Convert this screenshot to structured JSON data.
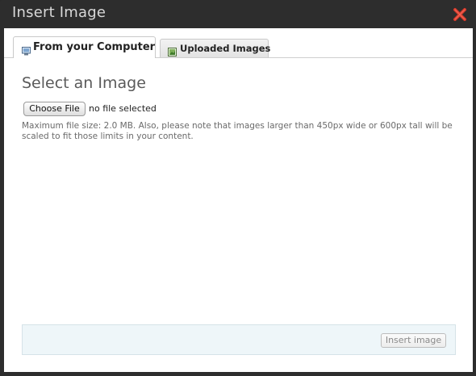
{
  "dialog": {
    "title": "Insert Image",
    "close_icon": "close-x-icon"
  },
  "tabs": [
    {
      "label": "From your Computer",
      "icon": "computer-icon",
      "active": true
    },
    {
      "label": "Uploaded Images",
      "icon": "image-icon",
      "active": false
    }
  ],
  "upload": {
    "heading": "Select an Image",
    "choose_label": "Choose File",
    "file_status": "no file selected",
    "hint": "Maximum file size: 2.0 MB. Also, please note that images larger than 450px wide or 600px tall will be scaled to fit those limits in your content."
  },
  "footer": {
    "insert_label": "Insert image",
    "insert_enabled": false
  },
  "colors": {
    "titlebar_bg": "#2d2d2d",
    "close_red": "#d93a2b",
    "footer_bg": "#eef6f9"
  }
}
